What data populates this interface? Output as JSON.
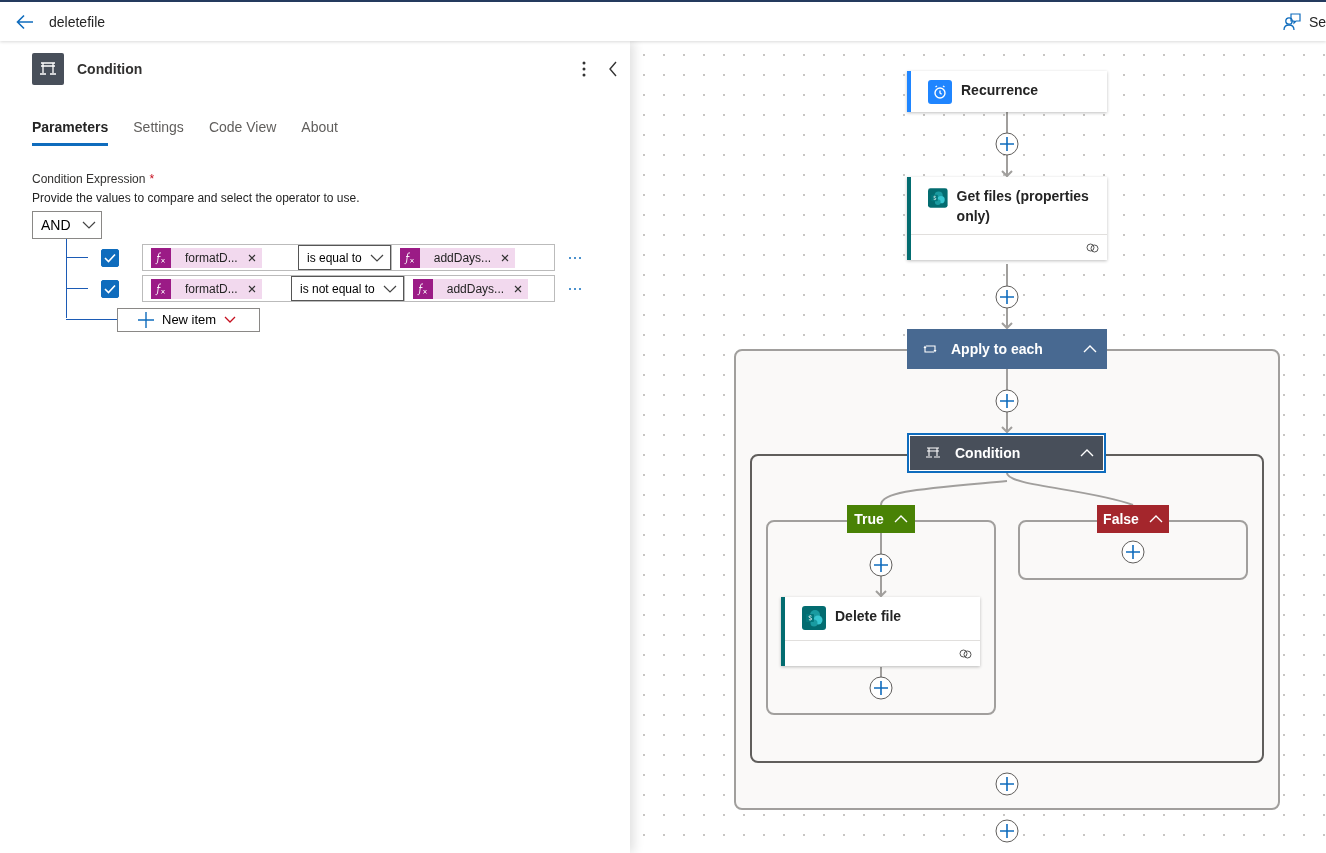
{
  "header": {
    "title": "deletefile",
    "right_text": "Se"
  },
  "panel": {
    "title": "Condition",
    "tabs": [
      {
        "label": "Parameters",
        "selected": true
      },
      {
        "label": "Settings",
        "selected": false
      },
      {
        "label": "Code View",
        "selected": false
      },
      {
        "label": "About",
        "selected": false
      }
    ],
    "field_label": "Condition Expression",
    "required_mark": "*",
    "description": "Provide the values to compare and select the operator to use.",
    "group_operator": "AND",
    "rows": [
      {
        "checked": true,
        "left": "formatD...",
        "operator": "is equal to",
        "right": "addDays..."
      },
      {
        "checked": true,
        "left": "formatD...",
        "operator": "is not equal to",
        "right": "addDays..."
      }
    ],
    "new_item": "New item"
  },
  "canvas": {
    "nodes": [
      {
        "kind": "trigger",
        "title": "Recurrence",
        "selected": false
      },
      {
        "kind": "sharepoint",
        "title": "Get files (properties only)",
        "selected": false
      },
      {
        "kind": "loop",
        "title": "Apply to each",
        "expanded": true,
        "selected": false
      },
      {
        "kind": "condition",
        "title": "Condition",
        "expanded": true,
        "selected": true
      },
      {
        "kind": "sharepoint",
        "title": "Delete file",
        "selected": false
      }
    ],
    "branches": [
      {
        "kind": "true",
        "label": "True",
        "expanded": true
      },
      {
        "kind": "false",
        "label": "False",
        "expanded": true
      }
    ]
  }
}
